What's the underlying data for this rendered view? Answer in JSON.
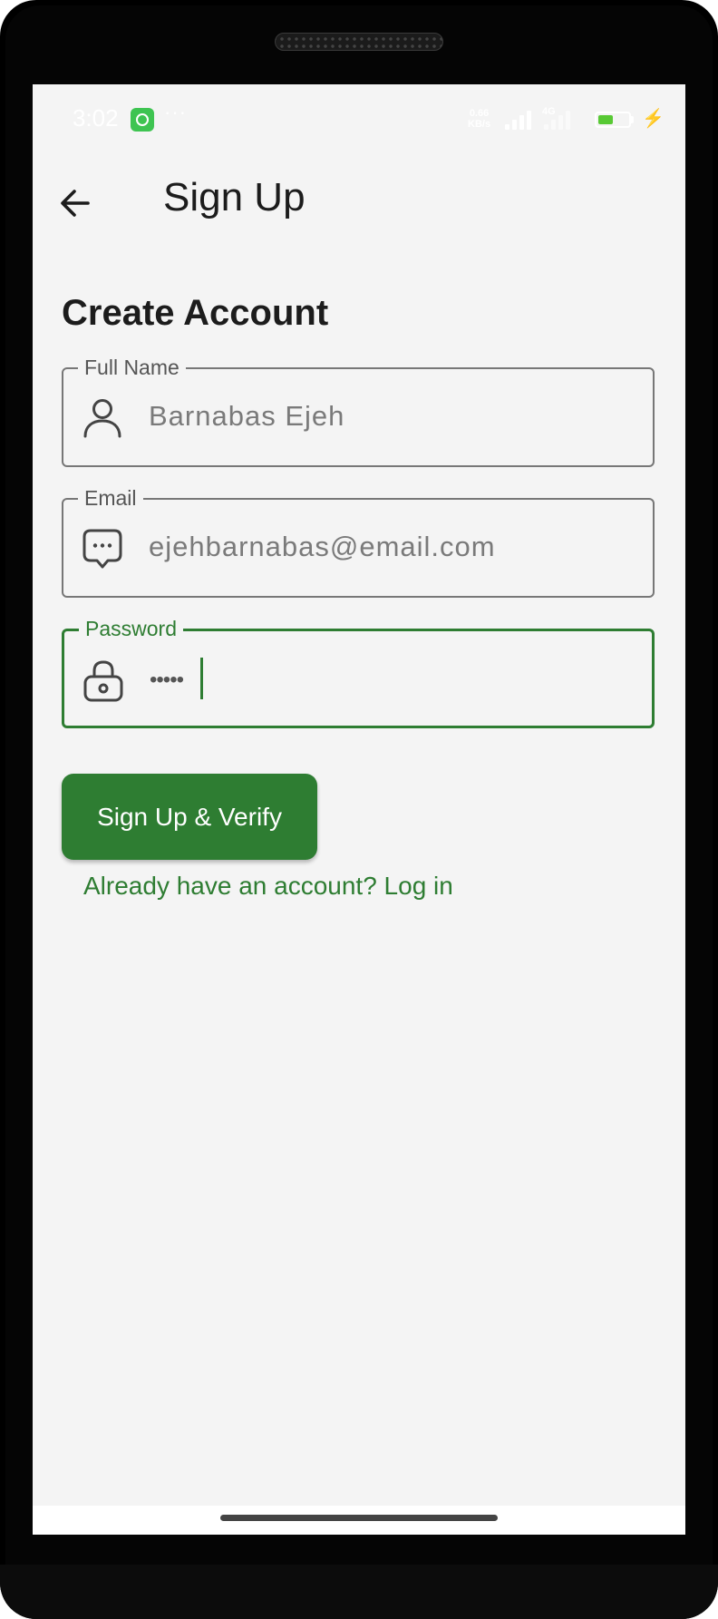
{
  "status_bar": {
    "time": "3:02",
    "more": "···",
    "net_speed_value": "0.66",
    "net_speed_unit": "KB/s",
    "network": "4G",
    "battery_level": "51",
    "battery_fraction": 0.51
  },
  "app_bar": {
    "title": "Sign Up"
  },
  "form": {
    "heading": "Create Account",
    "full_name": {
      "label": "Full Name",
      "value": "Barnabas Ejeh"
    },
    "email": {
      "label": "Email",
      "value": "ejehbarnabas@email.com"
    },
    "password": {
      "label": "Password",
      "value": "•••••"
    },
    "submit_label": "Sign Up & Verify",
    "login_link": "Already have an account? Log in"
  },
  "colors": {
    "accent": "#2e7d32",
    "background": "#f4f4f4",
    "battery": "#58c934",
    "whatsapp": "#3ec451"
  },
  "icons": [
    "back-arrow-icon",
    "person-icon",
    "chat-bubble-icon",
    "lock-icon",
    "whatsapp-icon",
    "charging-icon"
  ]
}
